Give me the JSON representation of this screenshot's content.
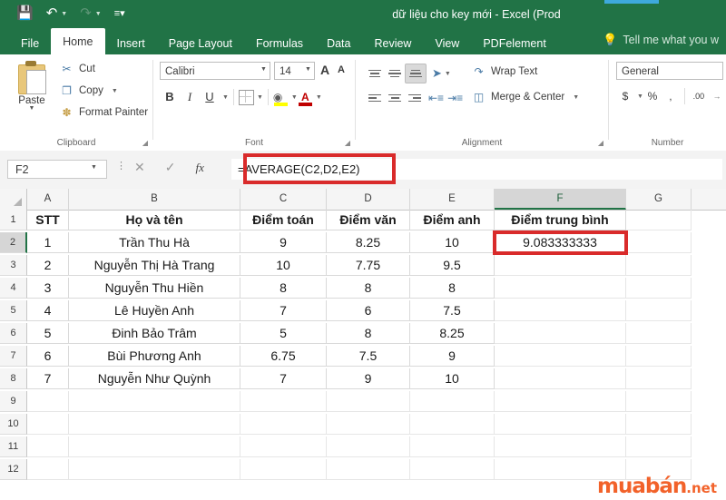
{
  "window": {
    "title": "dữ liệu cho key mới - Excel (Prod",
    "quick_access": [
      {
        "name": "save-icon",
        "glyph": "💾"
      },
      {
        "name": "undo-icon",
        "glyph": "↶"
      },
      {
        "name": "redo-icon",
        "glyph": "↷"
      },
      {
        "name": "customize-qat-icon",
        "glyph": "═"
      }
    ]
  },
  "tabs": [
    {
      "label": "File",
      "active": false
    },
    {
      "label": "Home",
      "active": true
    },
    {
      "label": "Insert",
      "active": false
    },
    {
      "label": "Page Layout",
      "active": false
    },
    {
      "label": "Formulas",
      "active": false
    },
    {
      "label": "Data",
      "active": false
    },
    {
      "label": "Review",
      "active": false
    },
    {
      "label": "View",
      "active": false
    },
    {
      "label": "PDFelement",
      "active": false
    }
  ],
  "tell_me": "Tell me what you w",
  "ribbon": {
    "clipboard": {
      "group_label": "Clipboard",
      "paste_label": "Paste",
      "items": [
        {
          "label": "Cut",
          "icon": "scissors-icon",
          "glyph": "✂"
        },
        {
          "label": "Copy",
          "icon": "copy-icon",
          "glyph": "❐"
        },
        {
          "label": "Format Painter",
          "icon": "format-painter-icon",
          "glyph": "🖌"
        }
      ]
    },
    "font": {
      "group_label": "Font",
      "font_name": "Calibri",
      "font_size": "14",
      "bold_label": "B",
      "italic_label": "I",
      "underline_label": "U",
      "grow_font_label": "A",
      "shrink_font_label": "A"
    },
    "alignment": {
      "group_label": "Alignment",
      "wrap_text_label": "Wrap Text",
      "merge_center_label": "Merge & Center"
    },
    "number": {
      "group_label": "Number",
      "format": "General",
      "currency_label": "$",
      "percent_label": "%",
      "comma_label": ",",
      "decimal_label": ".00"
    }
  },
  "formula_bar": {
    "name_box": "F2",
    "formula": "=AVERAGE(C2,D2,E2)",
    "cancel_icon": "✕",
    "enter_icon": "✓",
    "fx_icon": "fx",
    "highlight_color": "#d92b2b"
  },
  "sheet": {
    "columns": [
      "A",
      "B",
      "C",
      "D",
      "E",
      "F",
      "G"
    ],
    "selected_column": "F",
    "rows": [
      "1",
      "2",
      "3",
      "4",
      "5",
      "6",
      "7",
      "8",
      "9",
      "10",
      "11",
      "12"
    ],
    "selected_row": "2",
    "headers": [
      "STT",
      "Họ và tên",
      "Điểm toán",
      "Điểm văn",
      "Điểm anh",
      "Điểm trung bình"
    ],
    "data": [
      [
        "1",
        "Trần Thu Hà",
        "9",
        "8.25",
        "10",
        "9.083333333"
      ],
      [
        "2",
        "Nguyễn Thị Hà Trang",
        "10",
        "7.75",
        "9.5",
        ""
      ],
      [
        "3",
        "Nguyễn Thu Hiền",
        "8",
        "8",
        "8",
        ""
      ],
      [
        "4",
        "Lê Huyền Anh",
        "7",
        "6",
        "7.5",
        ""
      ],
      [
        "5",
        "Đinh Bảo Trâm",
        "5",
        "8",
        "8.25",
        ""
      ],
      [
        "6",
        "Bùi Phương Anh",
        "6.75",
        "7.5",
        "9",
        ""
      ],
      [
        "7",
        "Nguyễn Như Quỳnh",
        "7",
        "9",
        "10",
        ""
      ]
    ],
    "highlighted_cell": "F2",
    "highlight_color": "#d92b2b"
  },
  "watermark": {
    "main": "muabán",
    "suffix": ".net",
    "color": "#f2622a"
  }
}
